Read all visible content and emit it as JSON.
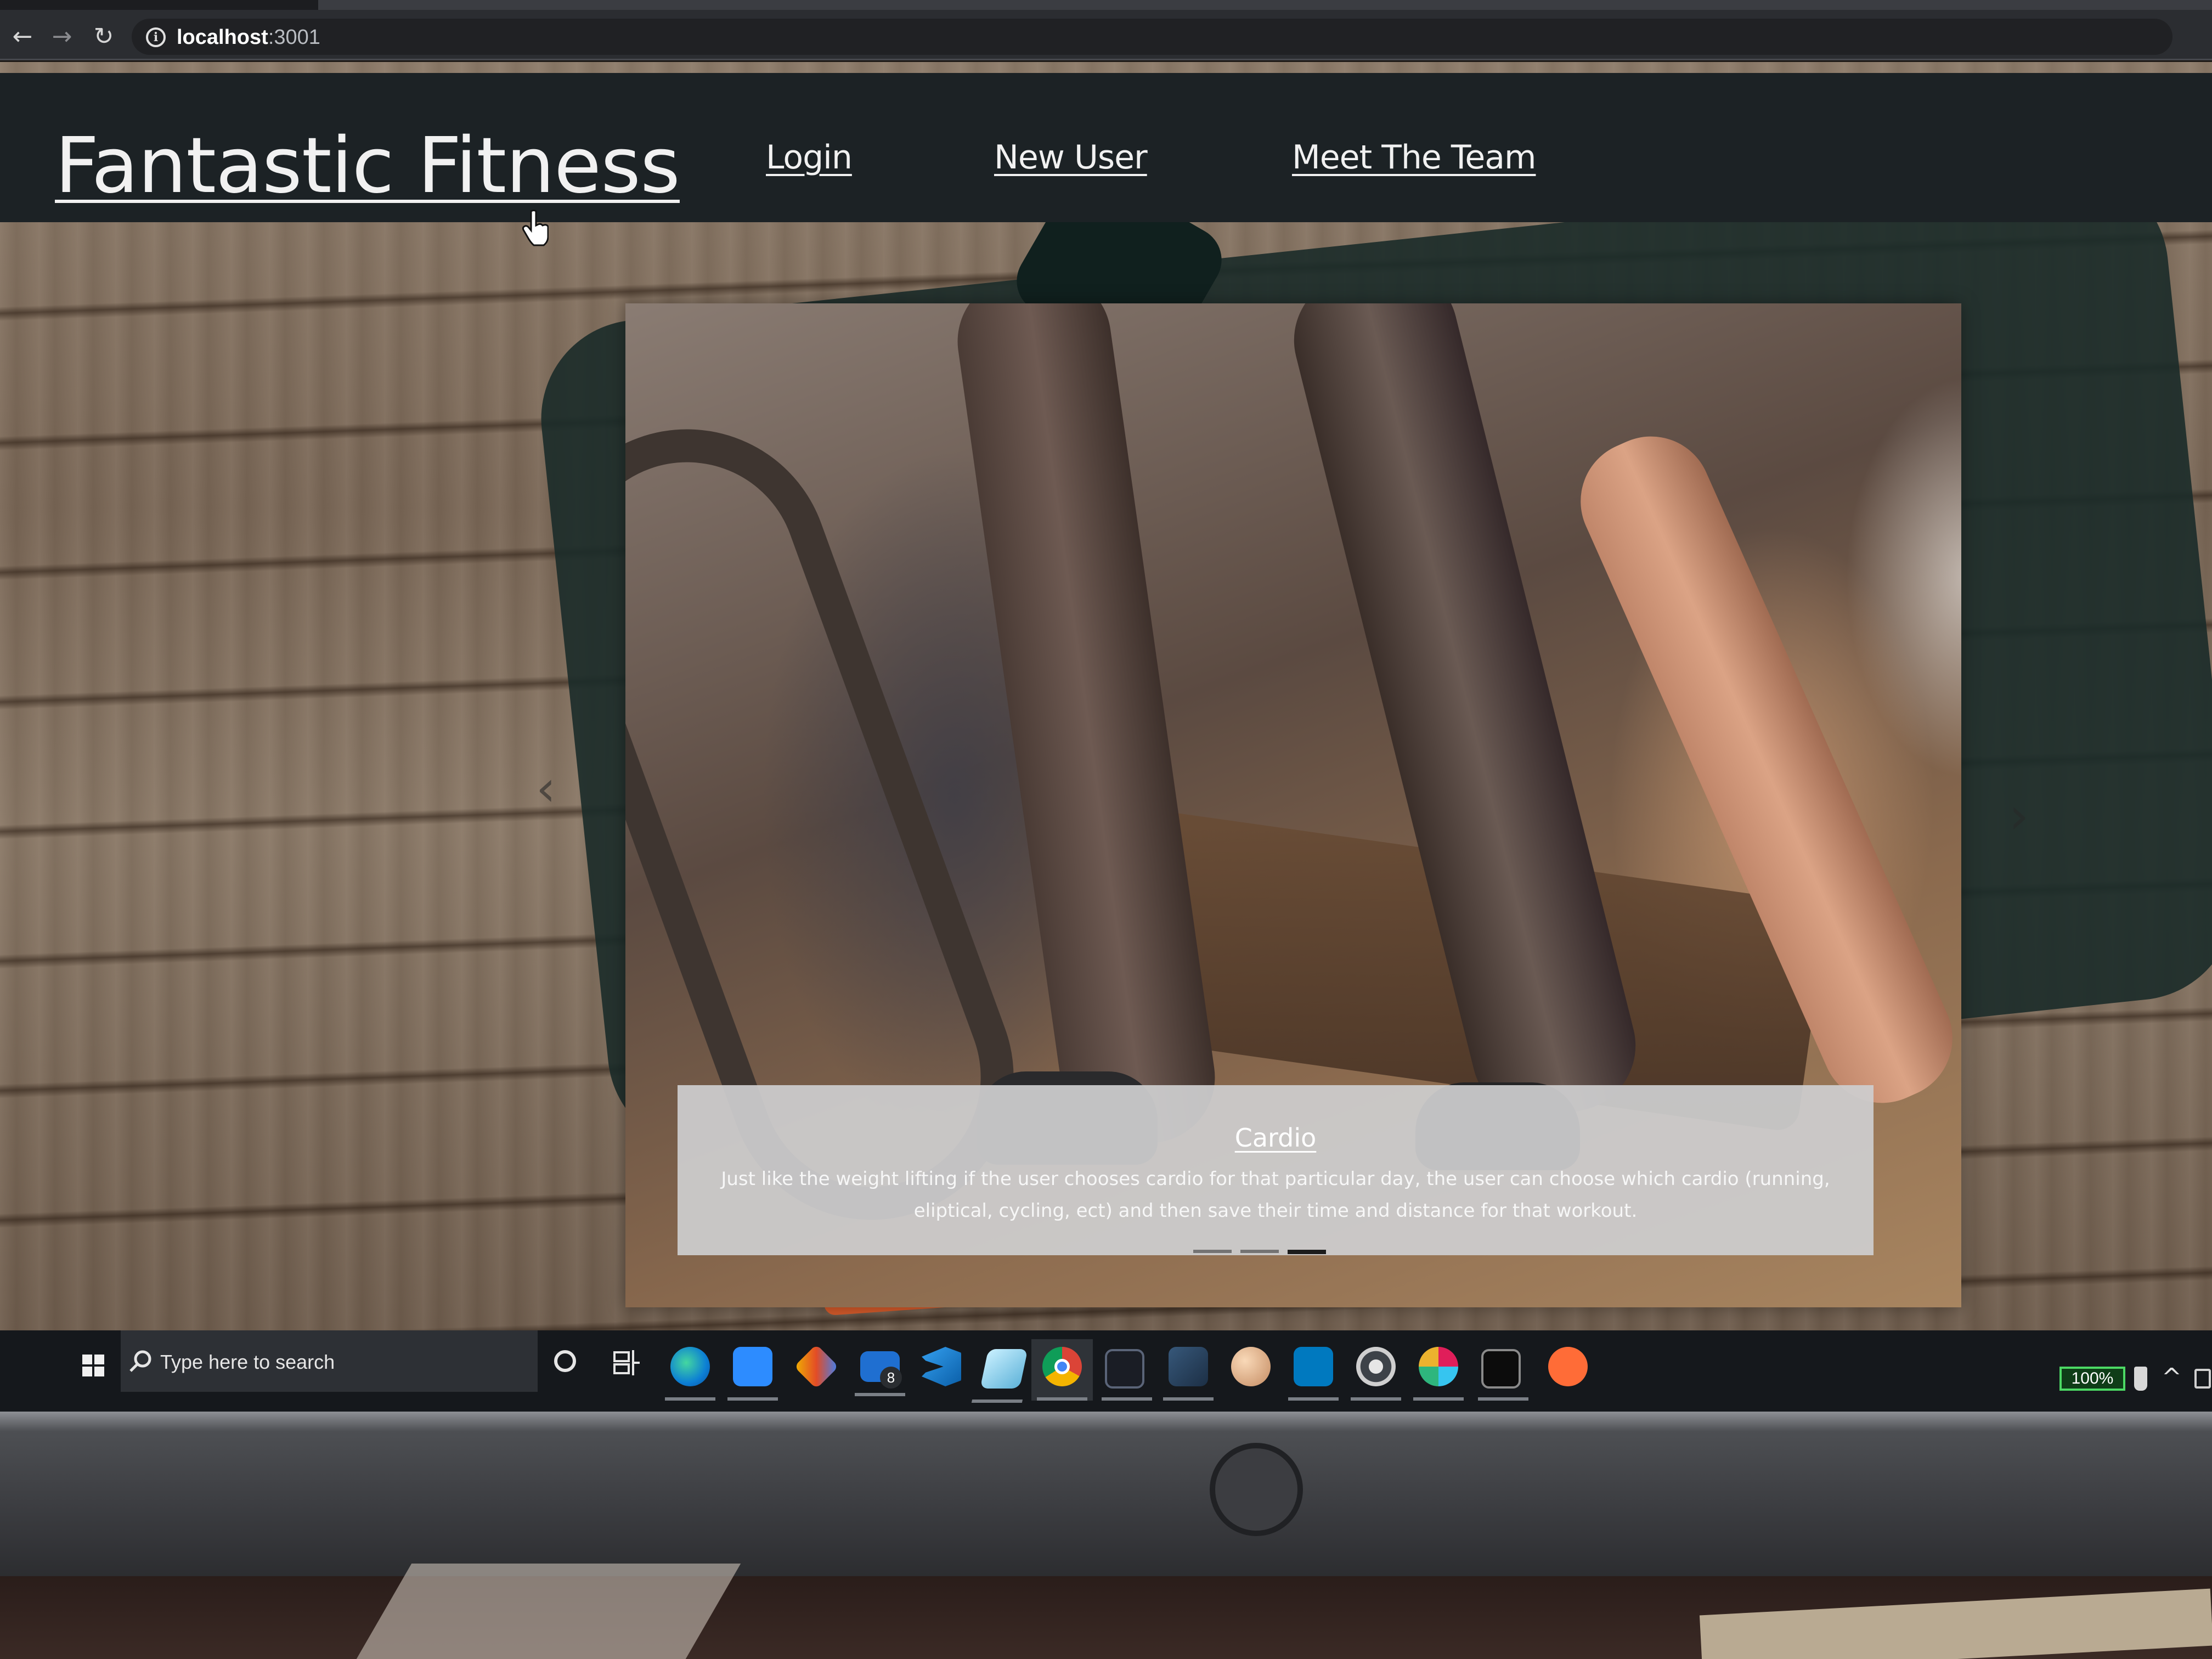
{
  "browser": {
    "back_glyph": "←",
    "forward_glyph": "→",
    "reload_glyph": "↻",
    "info_glyph": "i",
    "address_host": "localhost",
    "address_port": ":3001"
  },
  "site": {
    "brand": "Fantastic Fitness",
    "nav": {
      "login": "Login",
      "new_user": "New User",
      "meet_team": "Meet The Team"
    },
    "header_bg": "#1c2225"
  },
  "carousel": {
    "prev_glyph": "‹",
    "next_glyph": "›",
    "active_index": 2,
    "slide_count": 3,
    "caption": {
      "title": "Cardio",
      "text": "Just like the weight lifting if the user chooses cardio for that particular day, the user can choose which cardio (running, eliptical, cycling, ect) and then save their time and distance for that workout."
    }
  },
  "taskbar": {
    "search_placeholder": "Type here to search",
    "mail_badge": "8",
    "battery": "100%",
    "tray_chevron": "^",
    "apps": [
      "edge-icon",
      "zoom-icon",
      "git-icon",
      "mail-icon",
      "vscode-icon",
      "notes-icon",
      "chrome-icon",
      "terminal-icon",
      "dbeaver-icon",
      "paint-icon",
      "trello-icon",
      "settings-icon",
      "slack-icon",
      "cmd-icon",
      "postman-icon"
    ]
  },
  "monitor": {
    "brand_logo": "hp"
  }
}
